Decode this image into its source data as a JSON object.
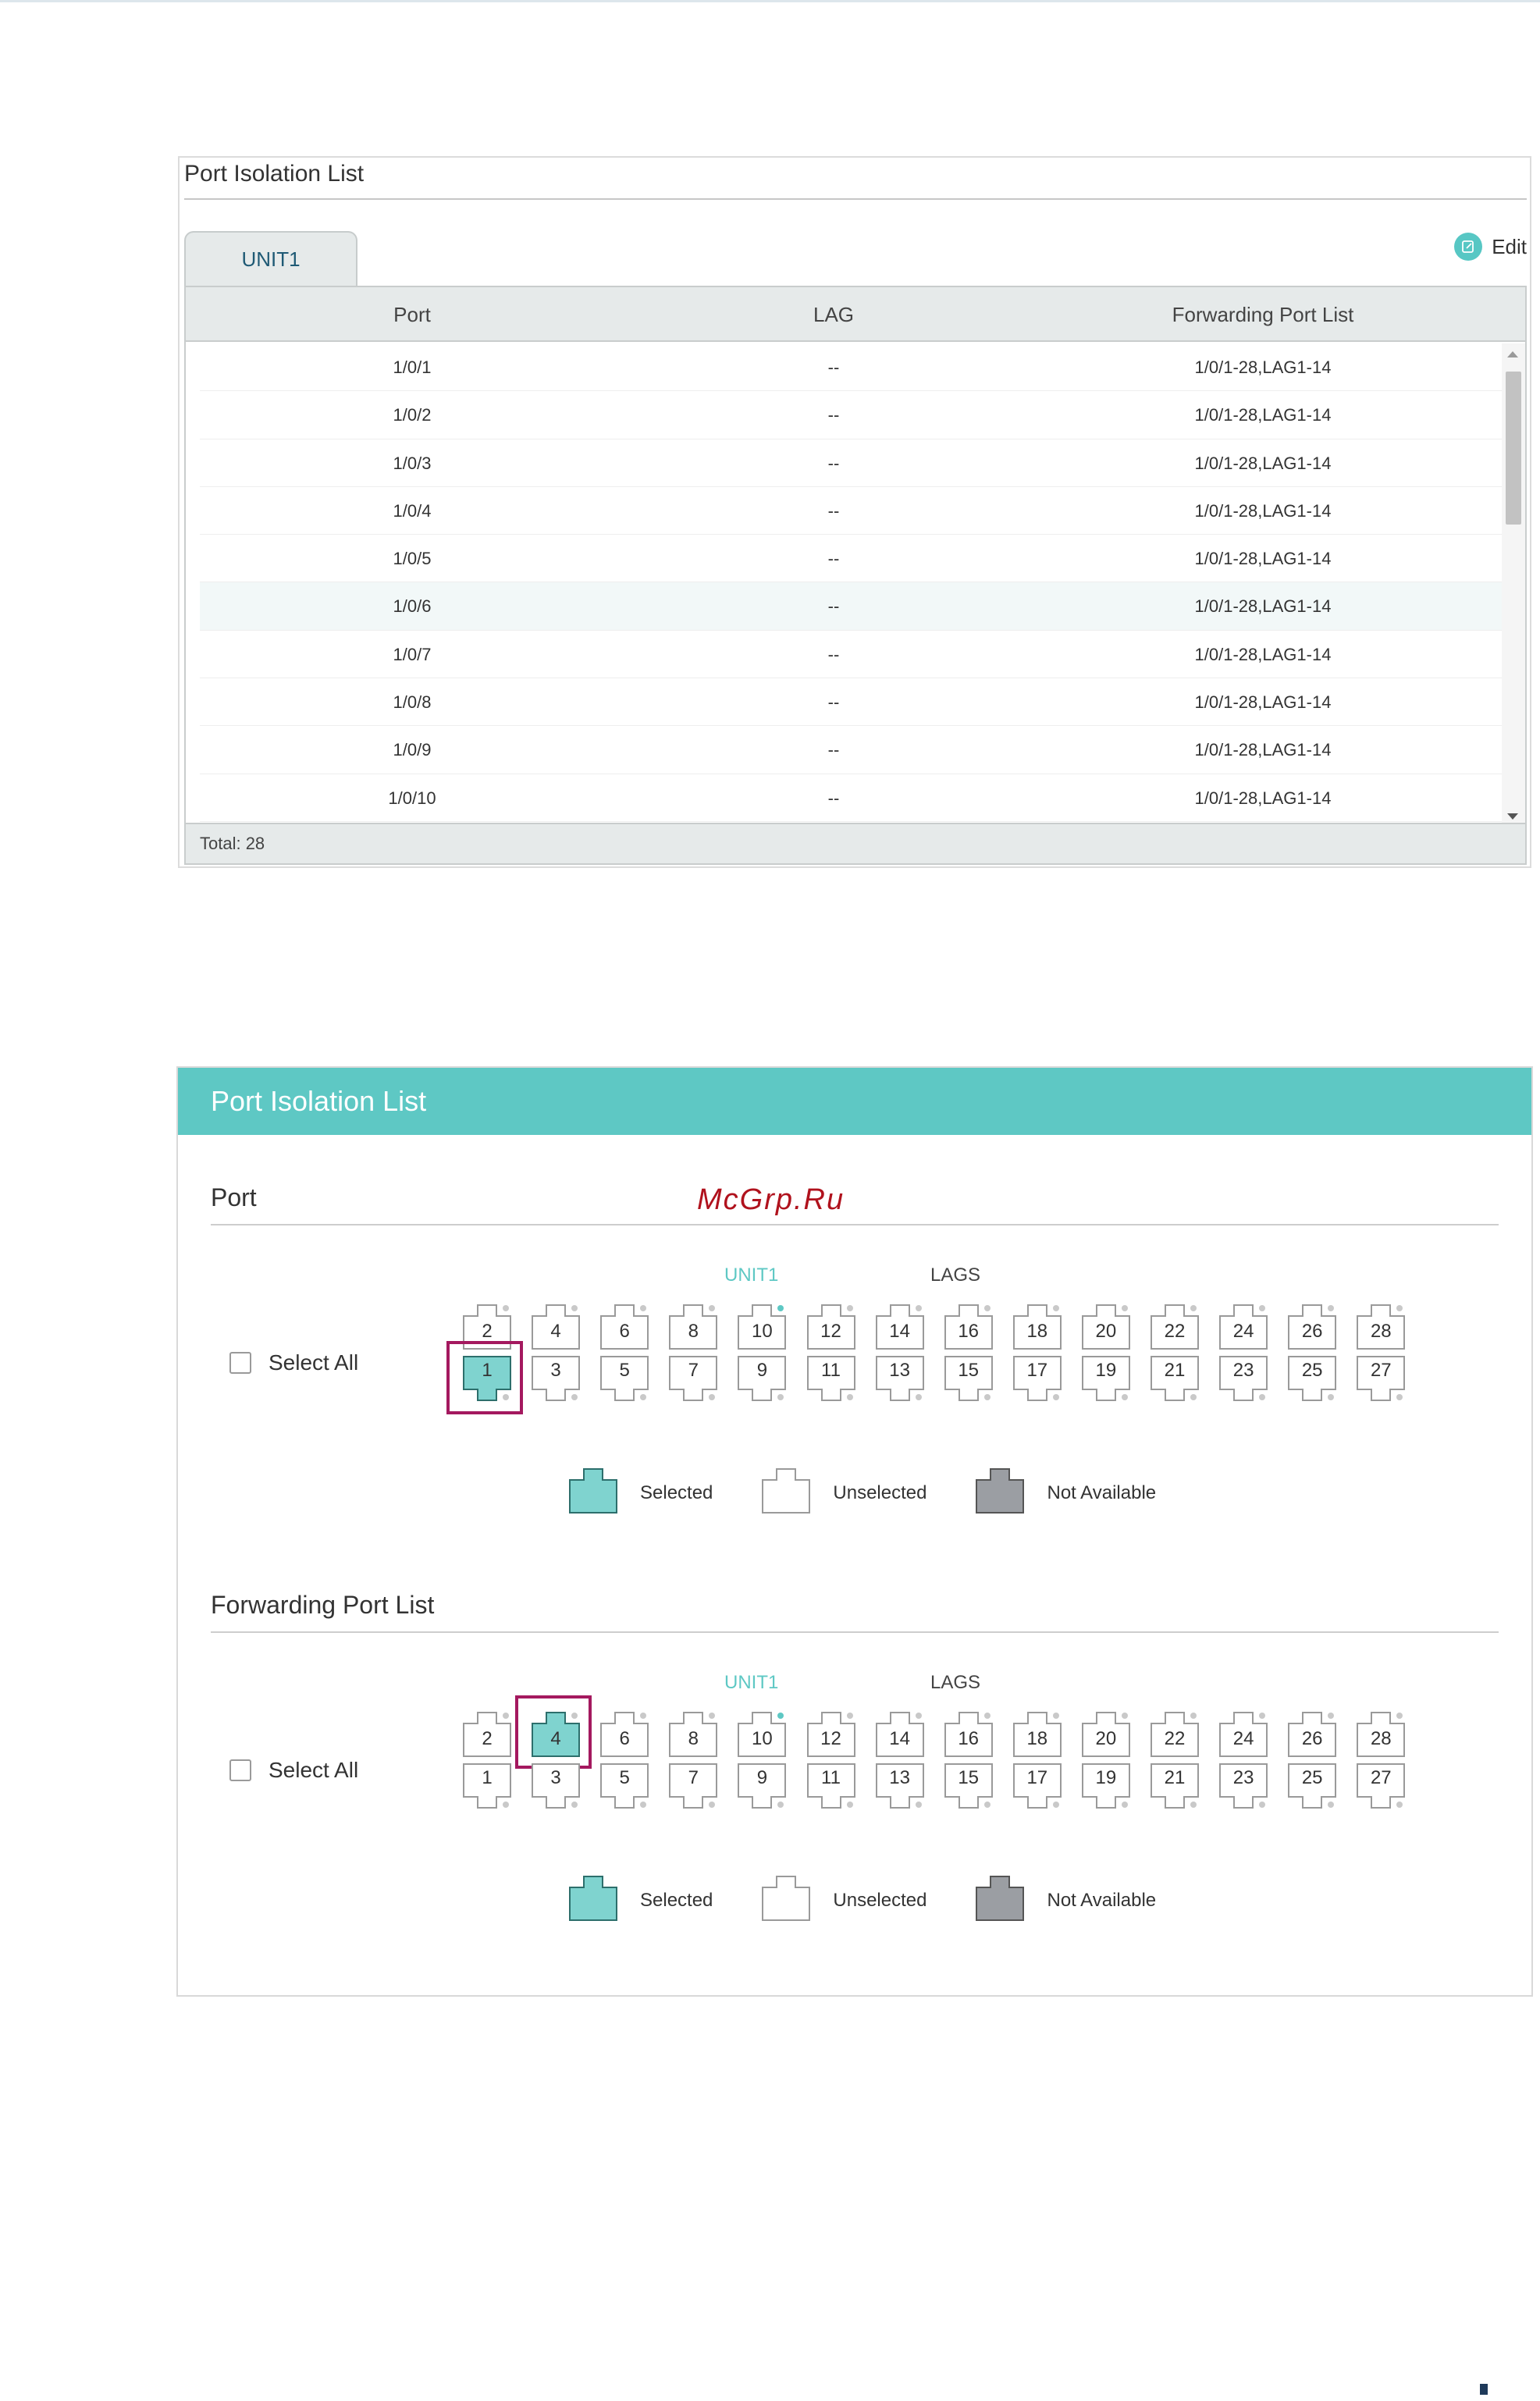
{
  "panel1": {
    "title": "Port Isolation List",
    "tab": "UNIT1",
    "edit_label": "Edit",
    "edit_icon": "edit-icon",
    "columns": [
      "Port",
      "LAG",
      "Forwarding Port List"
    ],
    "rows": [
      {
        "port": "1/0/1",
        "lag": "--",
        "fwd": "1/0/1-28,LAG1-14"
      },
      {
        "port": "1/0/2",
        "lag": "--",
        "fwd": "1/0/1-28,LAG1-14"
      },
      {
        "port": "1/0/3",
        "lag": "--",
        "fwd": "1/0/1-28,LAG1-14"
      },
      {
        "port": "1/0/4",
        "lag": "--",
        "fwd": "1/0/1-28,LAG1-14"
      },
      {
        "port": "1/0/5",
        "lag": "--",
        "fwd": "1/0/1-28,LAG1-14"
      },
      {
        "port": "1/0/6",
        "lag": "--",
        "fwd": "1/0/1-28,LAG1-14"
      },
      {
        "port": "1/0/7",
        "lag": "--",
        "fwd": "1/0/1-28,LAG1-14"
      },
      {
        "port": "1/0/8",
        "lag": "--",
        "fwd": "1/0/1-28,LAG1-14"
      },
      {
        "port": "1/0/9",
        "lag": "--",
        "fwd": "1/0/1-28,LAG1-14"
      },
      {
        "port": "1/0/10",
        "lag": "--",
        "fwd": "1/0/1-28,LAG1-14"
      }
    ],
    "highlighted_row": 5,
    "total": "Total: 28"
  },
  "panel2": {
    "title": "Port Isolation List",
    "watermark": "McGrp.Ru",
    "colors": {
      "accent": "#5ec8c4",
      "selected": "#7fd3cf",
      "not_available": "#9b9ea3",
      "highlight_box": "#a4195f"
    },
    "sections": [
      {
        "title": "Port",
        "unit_label": "UNIT1",
        "lags_label": "LAGS",
        "select_all": "Select All",
        "top_ports": [
          "2",
          "4",
          "6",
          "8",
          "10",
          "12",
          "14",
          "16",
          "18",
          "20",
          "22",
          "24",
          "26",
          "28"
        ],
        "bottom_ports": [
          "1",
          "3",
          "5",
          "7",
          "9",
          "11",
          "13",
          "15",
          "17",
          "19",
          "21",
          "23",
          "25",
          "27"
        ],
        "selected": [
          "1"
        ],
        "active_indicator": [
          "10"
        ]
      },
      {
        "title": "Forwarding Port List",
        "unit_label": "UNIT1",
        "lags_label": "LAGS",
        "select_all": "Select All",
        "top_ports": [
          "2",
          "4",
          "6",
          "8",
          "10",
          "12",
          "14",
          "16",
          "18",
          "20",
          "22",
          "24",
          "26",
          "28"
        ],
        "bottom_ports": [
          "1",
          "3",
          "5",
          "7",
          "9",
          "11",
          "13",
          "15",
          "17",
          "19",
          "21",
          "23",
          "25",
          "27"
        ],
        "selected": [
          "4"
        ],
        "active_indicator": [
          "10"
        ]
      }
    ],
    "legend": {
      "selected": "Selected",
      "unselected": "Unselected",
      "not_available": "Not Available"
    }
  }
}
